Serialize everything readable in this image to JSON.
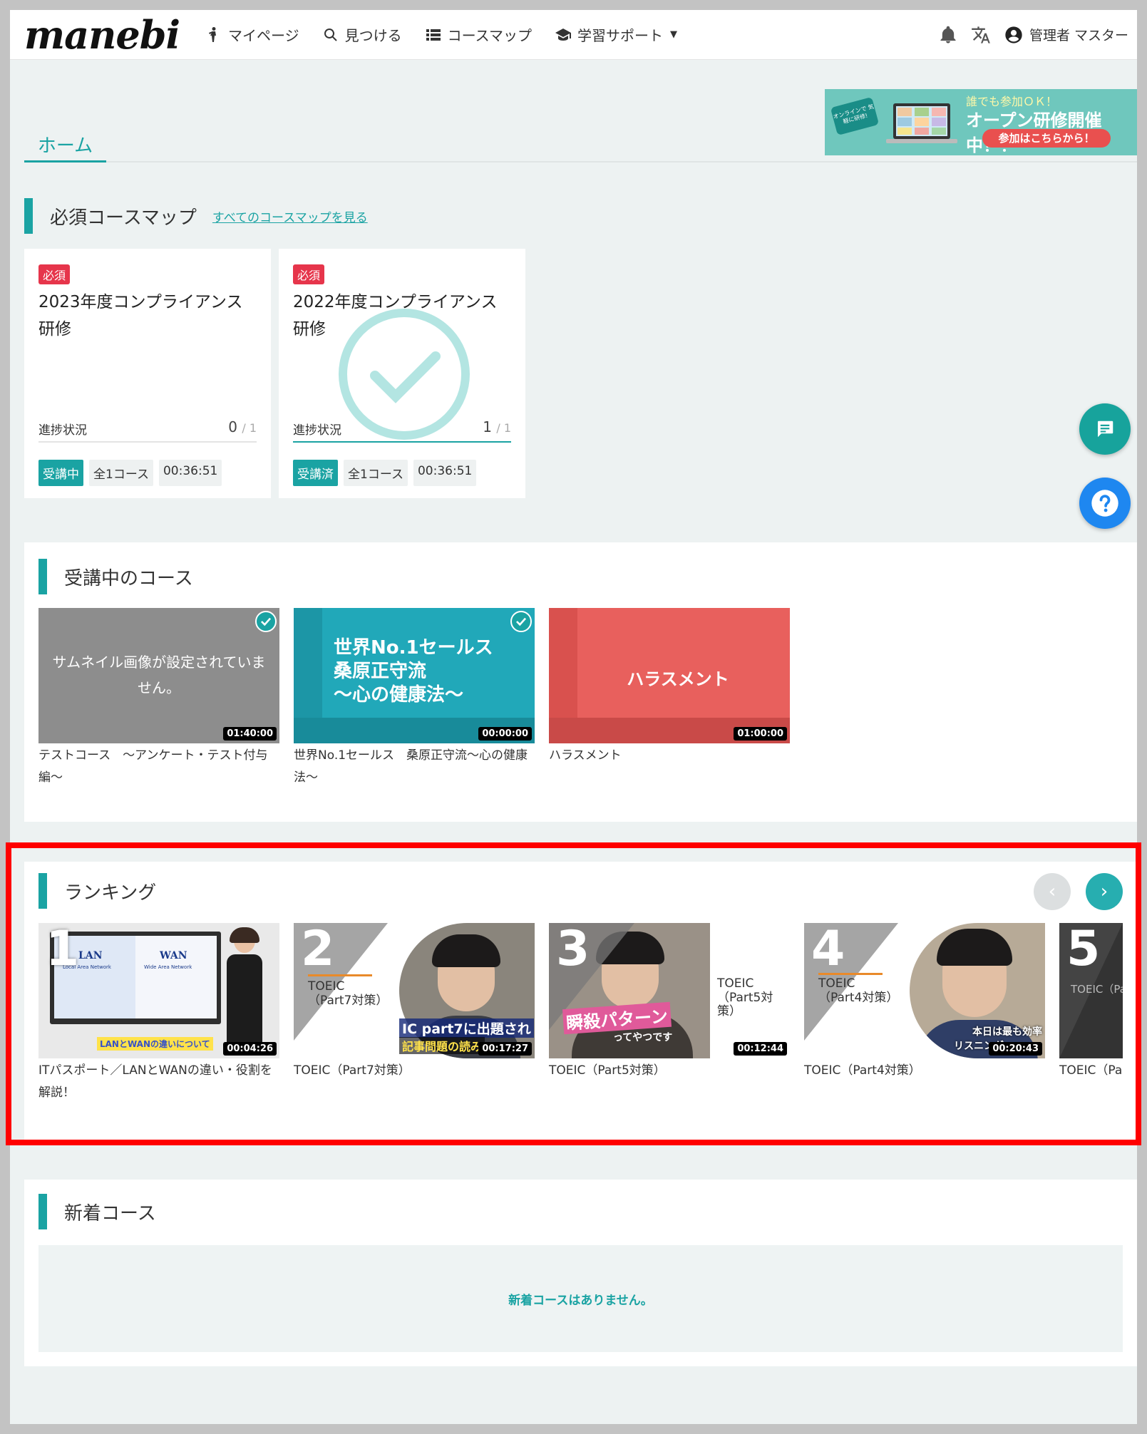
{
  "header": {
    "logo": "manebi",
    "nav": [
      {
        "label": "マイページ",
        "icon": "person-walking-icon"
      },
      {
        "label": "見つける",
        "icon": "search-icon"
      },
      {
        "label": "コースマップ",
        "icon": "list-icon"
      },
      {
        "label": "学習サポート",
        "icon": "graduation-cap-icon"
      }
    ],
    "user_name": "管理者 マスター"
  },
  "tabs": {
    "home": "ホーム"
  },
  "banner": {
    "badge": "オンラインで 気軽に研修!",
    "line1": "誰でも参加ＯＫ！",
    "line2": "オープン研修開催中！！",
    "button": "参加はこちらから！"
  },
  "required_maps": {
    "title": "必須コースマップ",
    "link": "すべてのコースマップを見る",
    "cards": [
      {
        "badge": "必須",
        "title": "2023年度コンプライアンス研修",
        "progress_label": "進捗状況",
        "done": "0",
        "total": "/ 1",
        "status": "受講中",
        "count": "全1コース",
        "time": "00:36:51"
      },
      {
        "badge": "必須",
        "title": "2022年度コンプライアンス研修",
        "progress_label": "進捗状況",
        "done": "1",
        "total": "/ 1",
        "status": "受講済",
        "count": "全1コース",
        "time": "00:36:51"
      }
    ]
  },
  "in_progress": {
    "title": "受講中のコース",
    "courses": [
      {
        "thumb_text": "サムネイル画像が設定されていません。",
        "duration": "01:40:00",
        "caption": "テストコース　～アンケート・テスト付与編～"
      },
      {
        "thumb_text_lines": [
          "世界No.1セールス",
          "桑原正守流",
          "～心の健康法～"
        ],
        "duration": "00:00:00",
        "caption": "世界No.1セールス　桑原正守流～心の健康法～"
      },
      {
        "thumb_text": "ハラスメント",
        "duration": "01:00:00",
        "caption": "ハラスメント"
      }
    ]
  },
  "ranking": {
    "title": "ランキング",
    "items": [
      {
        "rank": "1",
        "duration": "00:04:26",
        "caption": "ITパスポート／LANとWANの違い・役割を解説！",
        "thumb_lan": "LAN",
        "thumb_wan": "WAN",
        "thumb_lan_sub": "Local Area Network",
        "thumb_wan_sub": "Wide Area Network",
        "thumb_footer": "LANとWANの違いについて"
      },
      {
        "rank": "2",
        "duration": "00:17:27",
        "caption": "TOEIC（Part7対策）",
        "label1": "TOEIC",
        "label2": "（Part7対策）",
        "overlay": "IC part7に出題され",
        "overlay2": "記事問題の読み"
      },
      {
        "rank": "3",
        "duration": "00:12:44",
        "caption": "TOEIC（Part5対策）",
        "label1": "TOEIC",
        "label2": "（Part5対策）",
        "overlay": "瞬殺パターン",
        "overlay2": "ってやつです"
      },
      {
        "rank": "4",
        "duration": "00:20:43",
        "caption": "TOEIC（Part4対策）",
        "label1": "TOEIC",
        "label2": "（Part4対策）",
        "overlay": "本日は最も効率",
        "overlay2": "リスニング"
      },
      {
        "rank": "5",
        "caption": "TOEIC（Pa",
        "label1": "TOEIC（Pa"
      }
    ]
  },
  "new_courses": {
    "title": "新着コース",
    "empty": "新着コースはありません。"
  },
  "colors": {
    "accent": "#1aa3a3",
    "required": "#e6354b",
    "highlight": "#ff0000"
  }
}
